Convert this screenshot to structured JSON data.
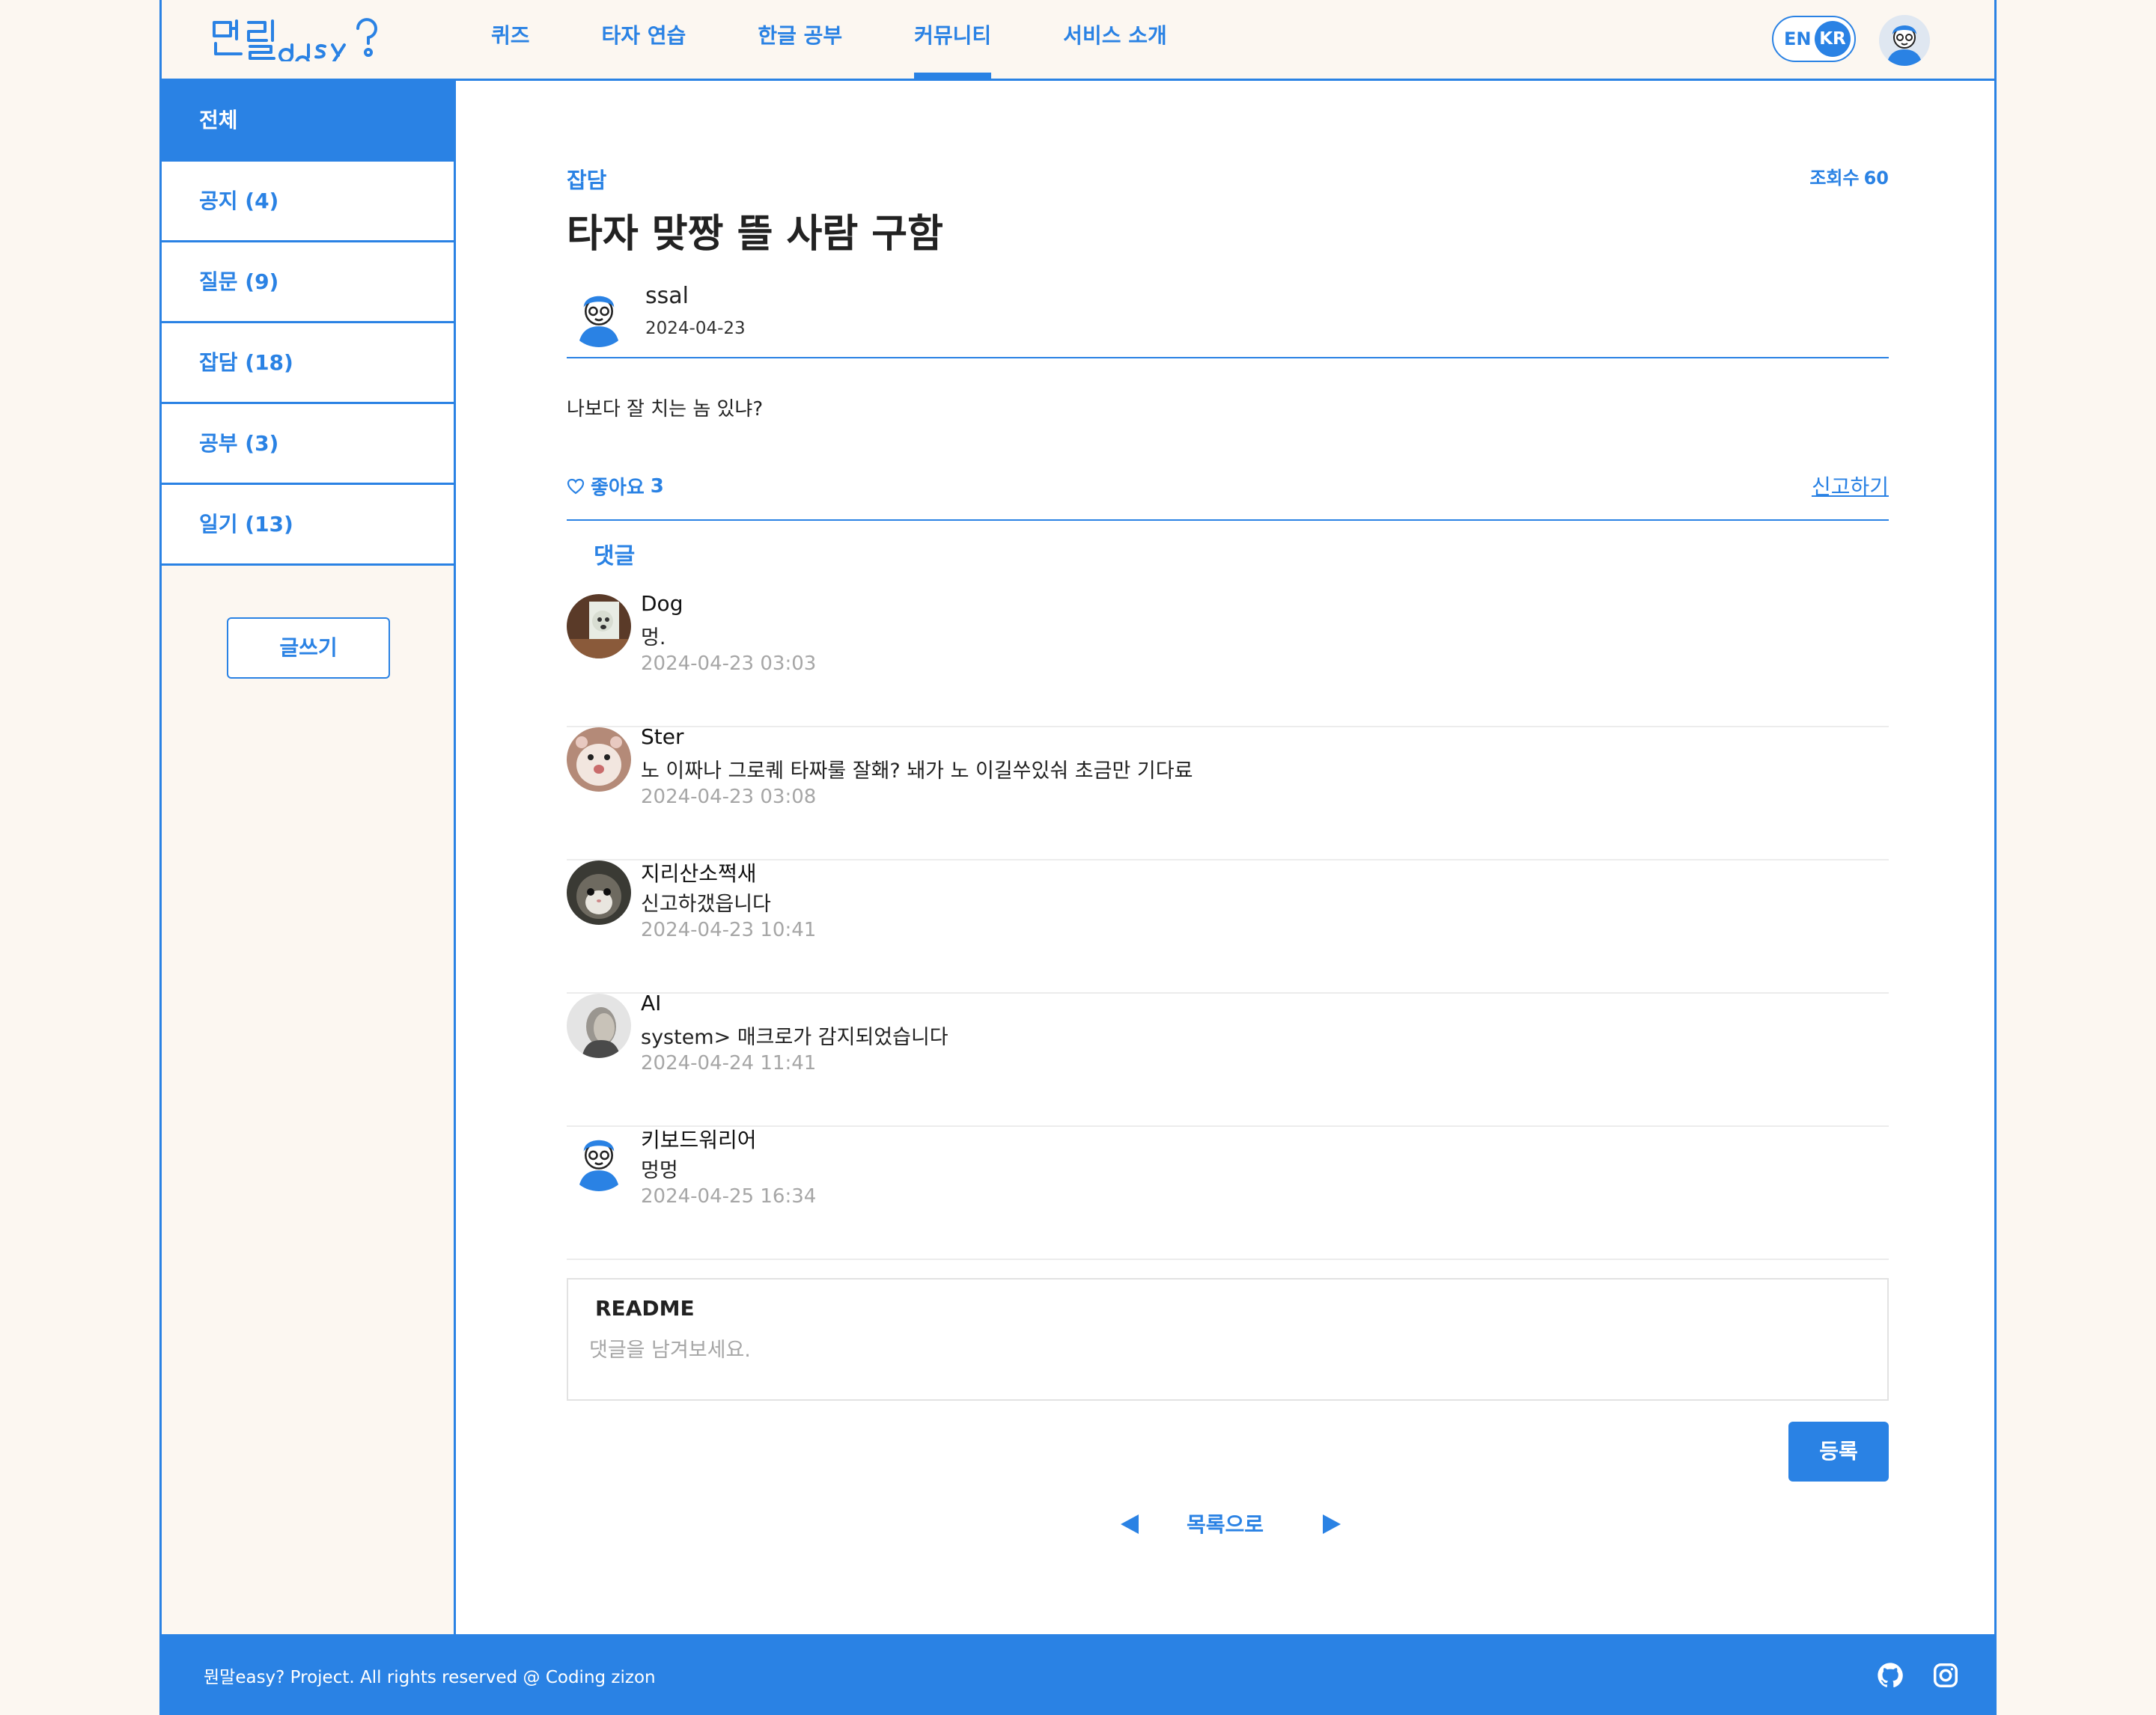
{
  "brand": {
    "logo_text": "뭔말easy?",
    "accent_color": "#2a82e4"
  },
  "nav": {
    "items": [
      {
        "label": "퀴즈"
      },
      {
        "label": "타자 연습"
      },
      {
        "label": "한글 공부"
      },
      {
        "label": "커뮤니티",
        "active": true
      },
      {
        "label": "서비스 소개"
      }
    ]
  },
  "lang": {
    "en": "EN",
    "kr": "KR",
    "selected": "KR"
  },
  "sidebar": {
    "items": [
      {
        "label": "전체",
        "active": true
      },
      {
        "label": "공지 (4)"
      },
      {
        "label": "질문 (9)"
      },
      {
        "label": "잡담 (18)"
      },
      {
        "label": "공부 (3)"
      },
      {
        "label": "일기 (13)"
      }
    ],
    "write_label": "글쓰기"
  },
  "post": {
    "category": "잡담",
    "views_label": "조회수",
    "views": "60",
    "title": "타자 맞짱 뜰 사람 구함",
    "author": "ssal",
    "date": "2024-04-23",
    "body": "나보다 잘 치는 놈 있냐?",
    "like_label": "좋아요",
    "like_count": "3",
    "report_label": "신고하기"
  },
  "comments": {
    "heading": "댓글",
    "items": [
      {
        "user": "Dog",
        "text": "멍.",
        "date": "2024-04-23 03:03",
        "avatar": "dog-photo"
      },
      {
        "user": "Ster",
        "text": "노 이짜나 그로퀘 타짜룰 잘홰? 놰가 노 이길쑤있숴 초금만 기다료",
        "date": "2024-04-23 03:08",
        "avatar": "hamster-photo"
      },
      {
        "user": "지리산소쩍새",
        "text": "신고하갰읍니다",
        "date": "2024-04-23 10:41",
        "avatar": "cat-photo"
      },
      {
        "user": "AI",
        "text": "system> 매크로가 감지되었습니다",
        "date": "2024-04-24 11:41",
        "avatar": "person-photo"
      },
      {
        "user": "키보드워리어",
        "text": "멍멍",
        "date": "2024-04-25 16:34",
        "avatar": "mascot"
      }
    ]
  },
  "comment_form": {
    "user": "README",
    "placeholder": "댓글을 남겨보세요.",
    "submit_label": "등록"
  },
  "pager": {
    "list_label": "목록으로"
  },
  "footer": {
    "text": "뭔말easy? Project. All rights reserved @ Coding zizon"
  }
}
